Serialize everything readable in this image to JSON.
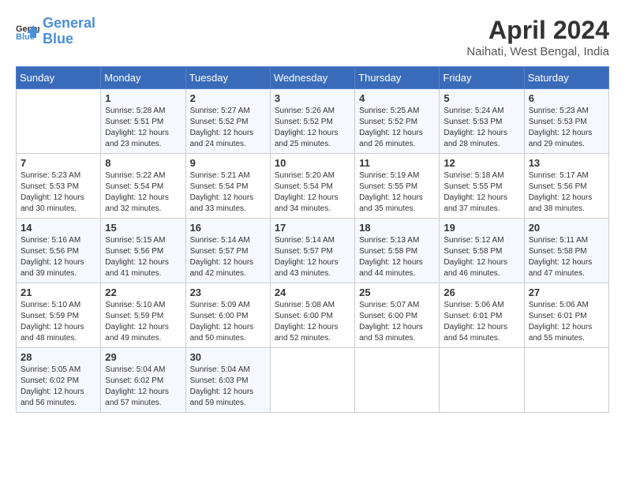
{
  "header": {
    "logo_line1": "General",
    "logo_line2": "Blue",
    "month": "April 2024",
    "location": "Naihati, West Bengal, India"
  },
  "weekdays": [
    "Sunday",
    "Monday",
    "Tuesday",
    "Wednesday",
    "Thursday",
    "Friday",
    "Saturday"
  ],
  "weeks": [
    [
      {
        "day": "",
        "info": ""
      },
      {
        "day": "1",
        "info": "Sunrise: 5:28 AM\nSunset: 5:51 PM\nDaylight: 12 hours\nand 23 minutes."
      },
      {
        "day": "2",
        "info": "Sunrise: 5:27 AM\nSunset: 5:52 PM\nDaylight: 12 hours\nand 24 minutes."
      },
      {
        "day": "3",
        "info": "Sunrise: 5:26 AM\nSunset: 5:52 PM\nDaylight: 12 hours\nand 25 minutes."
      },
      {
        "day": "4",
        "info": "Sunrise: 5:25 AM\nSunset: 5:52 PM\nDaylight: 12 hours\nand 26 minutes."
      },
      {
        "day": "5",
        "info": "Sunrise: 5:24 AM\nSunset: 5:53 PM\nDaylight: 12 hours\nand 28 minutes."
      },
      {
        "day": "6",
        "info": "Sunrise: 5:23 AM\nSunset: 5:53 PM\nDaylight: 12 hours\nand 29 minutes."
      }
    ],
    [
      {
        "day": "7",
        "info": "Sunrise: 5:23 AM\nSunset: 5:53 PM\nDaylight: 12 hours\nand 30 minutes."
      },
      {
        "day": "8",
        "info": "Sunrise: 5:22 AM\nSunset: 5:54 PM\nDaylight: 12 hours\nand 32 minutes."
      },
      {
        "day": "9",
        "info": "Sunrise: 5:21 AM\nSunset: 5:54 PM\nDaylight: 12 hours\nand 33 minutes."
      },
      {
        "day": "10",
        "info": "Sunrise: 5:20 AM\nSunset: 5:54 PM\nDaylight: 12 hours\nand 34 minutes."
      },
      {
        "day": "11",
        "info": "Sunrise: 5:19 AM\nSunset: 5:55 PM\nDaylight: 12 hours\nand 35 minutes."
      },
      {
        "day": "12",
        "info": "Sunrise: 5:18 AM\nSunset: 5:55 PM\nDaylight: 12 hours\nand 37 minutes."
      },
      {
        "day": "13",
        "info": "Sunrise: 5:17 AM\nSunset: 5:56 PM\nDaylight: 12 hours\nand 38 minutes."
      }
    ],
    [
      {
        "day": "14",
        "info": "Sunrise: 5:16 AM\nSunset: 5:56 PM\nDaylight: 12 hours\nand 39 minutes."
      },
      {
        "day": "15",
        "info": "Sunrise: 5:15 AM\nSunset: 5:56 PM\nDaylight: 12 hours\nand 41 minutes."
      },
      {
        "day": "16",
        "info": "Sunrise: 5:14 AM\nSunset: 5:57 PM\nDaylight: 12 hours\nand 42 minutes."
      },
      {
        "day": "17",
        "info": "Sunrise: 5:14 AM\nSunset: 5:57 PM\nDaylight: 12 hours\nand 43 minutes."
      },
      {
        "day": "18",
        "info": "Sunrise: 5:13 AM\nSunset: 5:58 PM\nDaylight: 12 hours\nand 44 minutes."
      },
      {
        "day": "19",
        "info": "Sunrise: 5:12 AM\nSunset: 5:58 PM\nDaylight: 12 hours\nand 46 minutes."
      },
      {
        "day": "20",
        "info": "Sunrise: 5:11 AM\nSunset: 5:58 PM\nDaylight: 12 hours\nand 47 minutes."
      }
    ],
    [
      {
        "day": "21",
        "info": "Sunrise: 5:10 AM\nSunset: 5:59 PM\nDaylight: 12 hours\nand 48 minutes."
      },
      {
        "day": "22",
        "info": "Sunrise: 5:10 AM\nSunset: 5:59 PM\nDaylight: 12 hours\nand 49 minutes."
      },
      {
        "day": "23",
        "info": "Sunrise: 5:09 AM\nSunset: 6:00 PM\nDaylight: 12 hours\nand 50 minutes."
      },
      {
        "day": "24",
        "info": "Sunrise: 5:08 AM\nSunset: 6:00 PM\nDaylight: 12 hours\nand 52 minutes."
      },
      {
        "day": "25",
        "info": "Sunrise: 5:07 AM\nSunset: 6:00 PM\nDaylight: 12 hours\nand 53 minutes."
      },
      {
        "day": "26",
        "info": "Sunrise: 5:06 AM\nSunset: 6:01 PM\nDaylight: 12 hours\nand 54 minutes."
      },
      {
        "day": "27",
        "info": "Sunrise: 5:06 AM\nSunset: 6:01 PM\nDaylight: 12 hours\nand 55 minutes."
      }
    ],
    [
      {
        "day": "28",
        "info": "Sunrise: 5:05 AM\nSunset: 6:02 PM\nDaylight: 12 hours\nand 56 minutes."
      },
      {
        "day": "29",
        "info": "Sunrise: 5:04 AM\nSunset: 6:02 PM\nDaylight: 12 hours\nand 57 minutes."
      },
      {
        "day": "30",
        "info": "Sunrise: 5:04 AM\nSunset: 6:03 PM\nDaylight: 12 hours\nand 59 minutes."
      },
      {
        "day": "",
        "info": ""
      },
      {
        "day": "",
        "info": ""
      },
      {
        "day": "",
        "info": ""
      },
      {
        "day": "",
        "info": ""
      }
    ]
  ]
}
